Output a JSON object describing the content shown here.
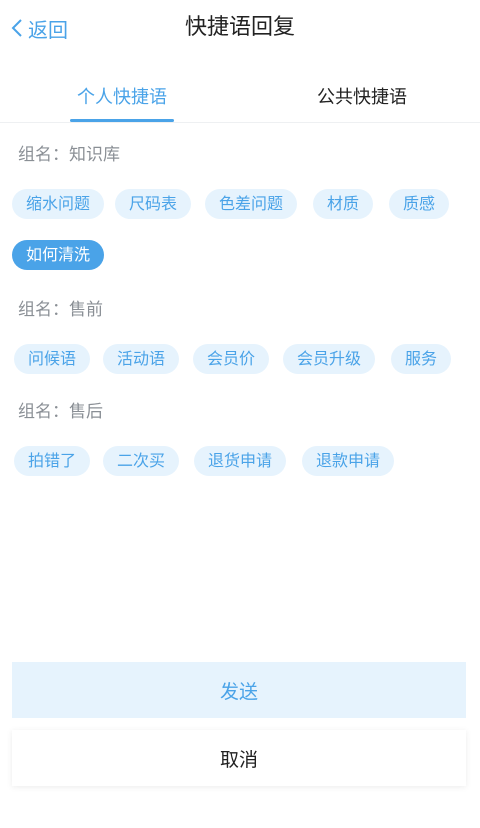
{
  "header": {
    "back_label": "返回",
    "title": "快捷语回复"
  },
  "tabs": [
    {
      "label": "个人快捷语",
      "active": true
    },
    {
      "label": "公共快捷语",
      "active": false
    }
  ],
  "groups": [
    {
      "label": "组名：知识库",
      "chips": [
        {
          "label": "缩水问题",
          "selected": false
        },
        {
          "label": "尺码表",
          "selected": false
        },
        {
          "label": "色差问题",
          "selected": false
        },
        {
          "label": "材质",
          "selected": false
        },
        {
          "label": "质感",
          "selected": false
        },
        {
          "label": "如何清洗",
          "selected": true
        }
      ]
    },
    {
      "label": "组名：售前",
      "chips": [
        {
          "label": "问候语",
          "selected": false
        },
        {
          "label": "活动语",
          "selected": false
        },
        {
          "label": "会员价",
          "selected": false
        },
        {
          "label": "会员升级",
          "selected": false
        },
        {
          "label": "服务",
          "selected": false
        }
      ]
    },
    {
      "label": "组名：售后",
      "chips": [
        {
          "label": "拍错了",
          "selected": false
        },
        {
          "label": "二次买",
          "selected": false
        },
        {
          "label": "退货申请",
          "selected": false
        },
        {
          "label": "退款申请",
          "selected": false
        }
      ]
    }
  ],
  "actions": {
    "send_label": "发送",
    "cancel_label": "取消"
  },
  "colors": {
    "accent": "#4aa3e8",
    "chip_bg": "#e6f3fd",
    "send_bg": "#e6f3fd"
  },
  "icons": {
    "back": "chevron-left-icon"
  }
}
